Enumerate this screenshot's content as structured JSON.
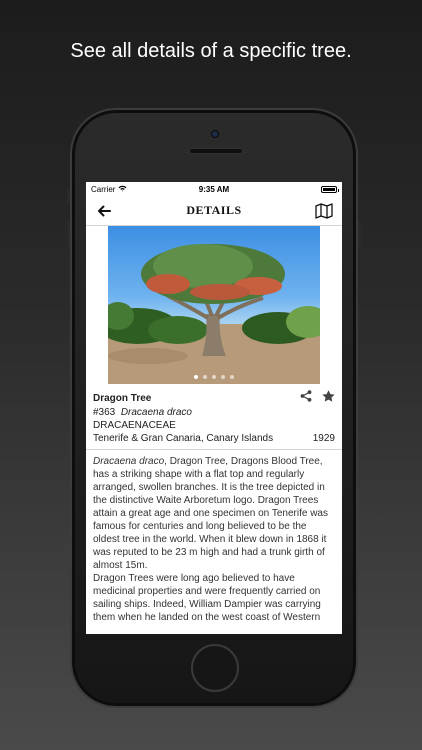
{
  "headline": "See all details of a specific tree.",
  "status_bar": {
    "carrier": "Carrier",
    "time": "9:35 AM"
  },
  "nav": {
    "title": "DETAILS",
    "back_icon": "arrow-left-icon",
    "map_icon": "map-icon"
  },
  "gallery": {
    "image_count": 5,
    "active_index": 0
  },
  "tree": {
    "common_name": "Dragon Tree",
    "number": "#363",
    "scientific_name": "Dracaena draco",
    "family": "DRACAENACEAE",
    "origin": "Tenerife & Gran Canaria, Canary Islands",
    "year": "1929"
  },
  "actions": {
    "share_icon": "share-icon",
    "favorite_icon": "star-icon"
  },
  "description": {
    "p1_italic": "Dracaena draco",
    "p1_rest": ", Dragon Tree, Dragons Blood Tree, has a striking shape with a flat top and regularly arranged, swollen branches. It is the tree depicted in the distinctive Waite Arboretum logo. Dragon Trees attain a great age and one specimen on Tenerife was famous for centuries and long believed to be the oldest tree in the world. When it blew down in 1868 it was reputed to be 23 m high and had a trunk girth of almost 15m.",
    "p2": "Dragon Trees were long ago believed to have medicinal properties and were frequently carried on sailing ships. Indeed, William Dampier was carrying them when he landed on the west coast of Western"
  }
}
